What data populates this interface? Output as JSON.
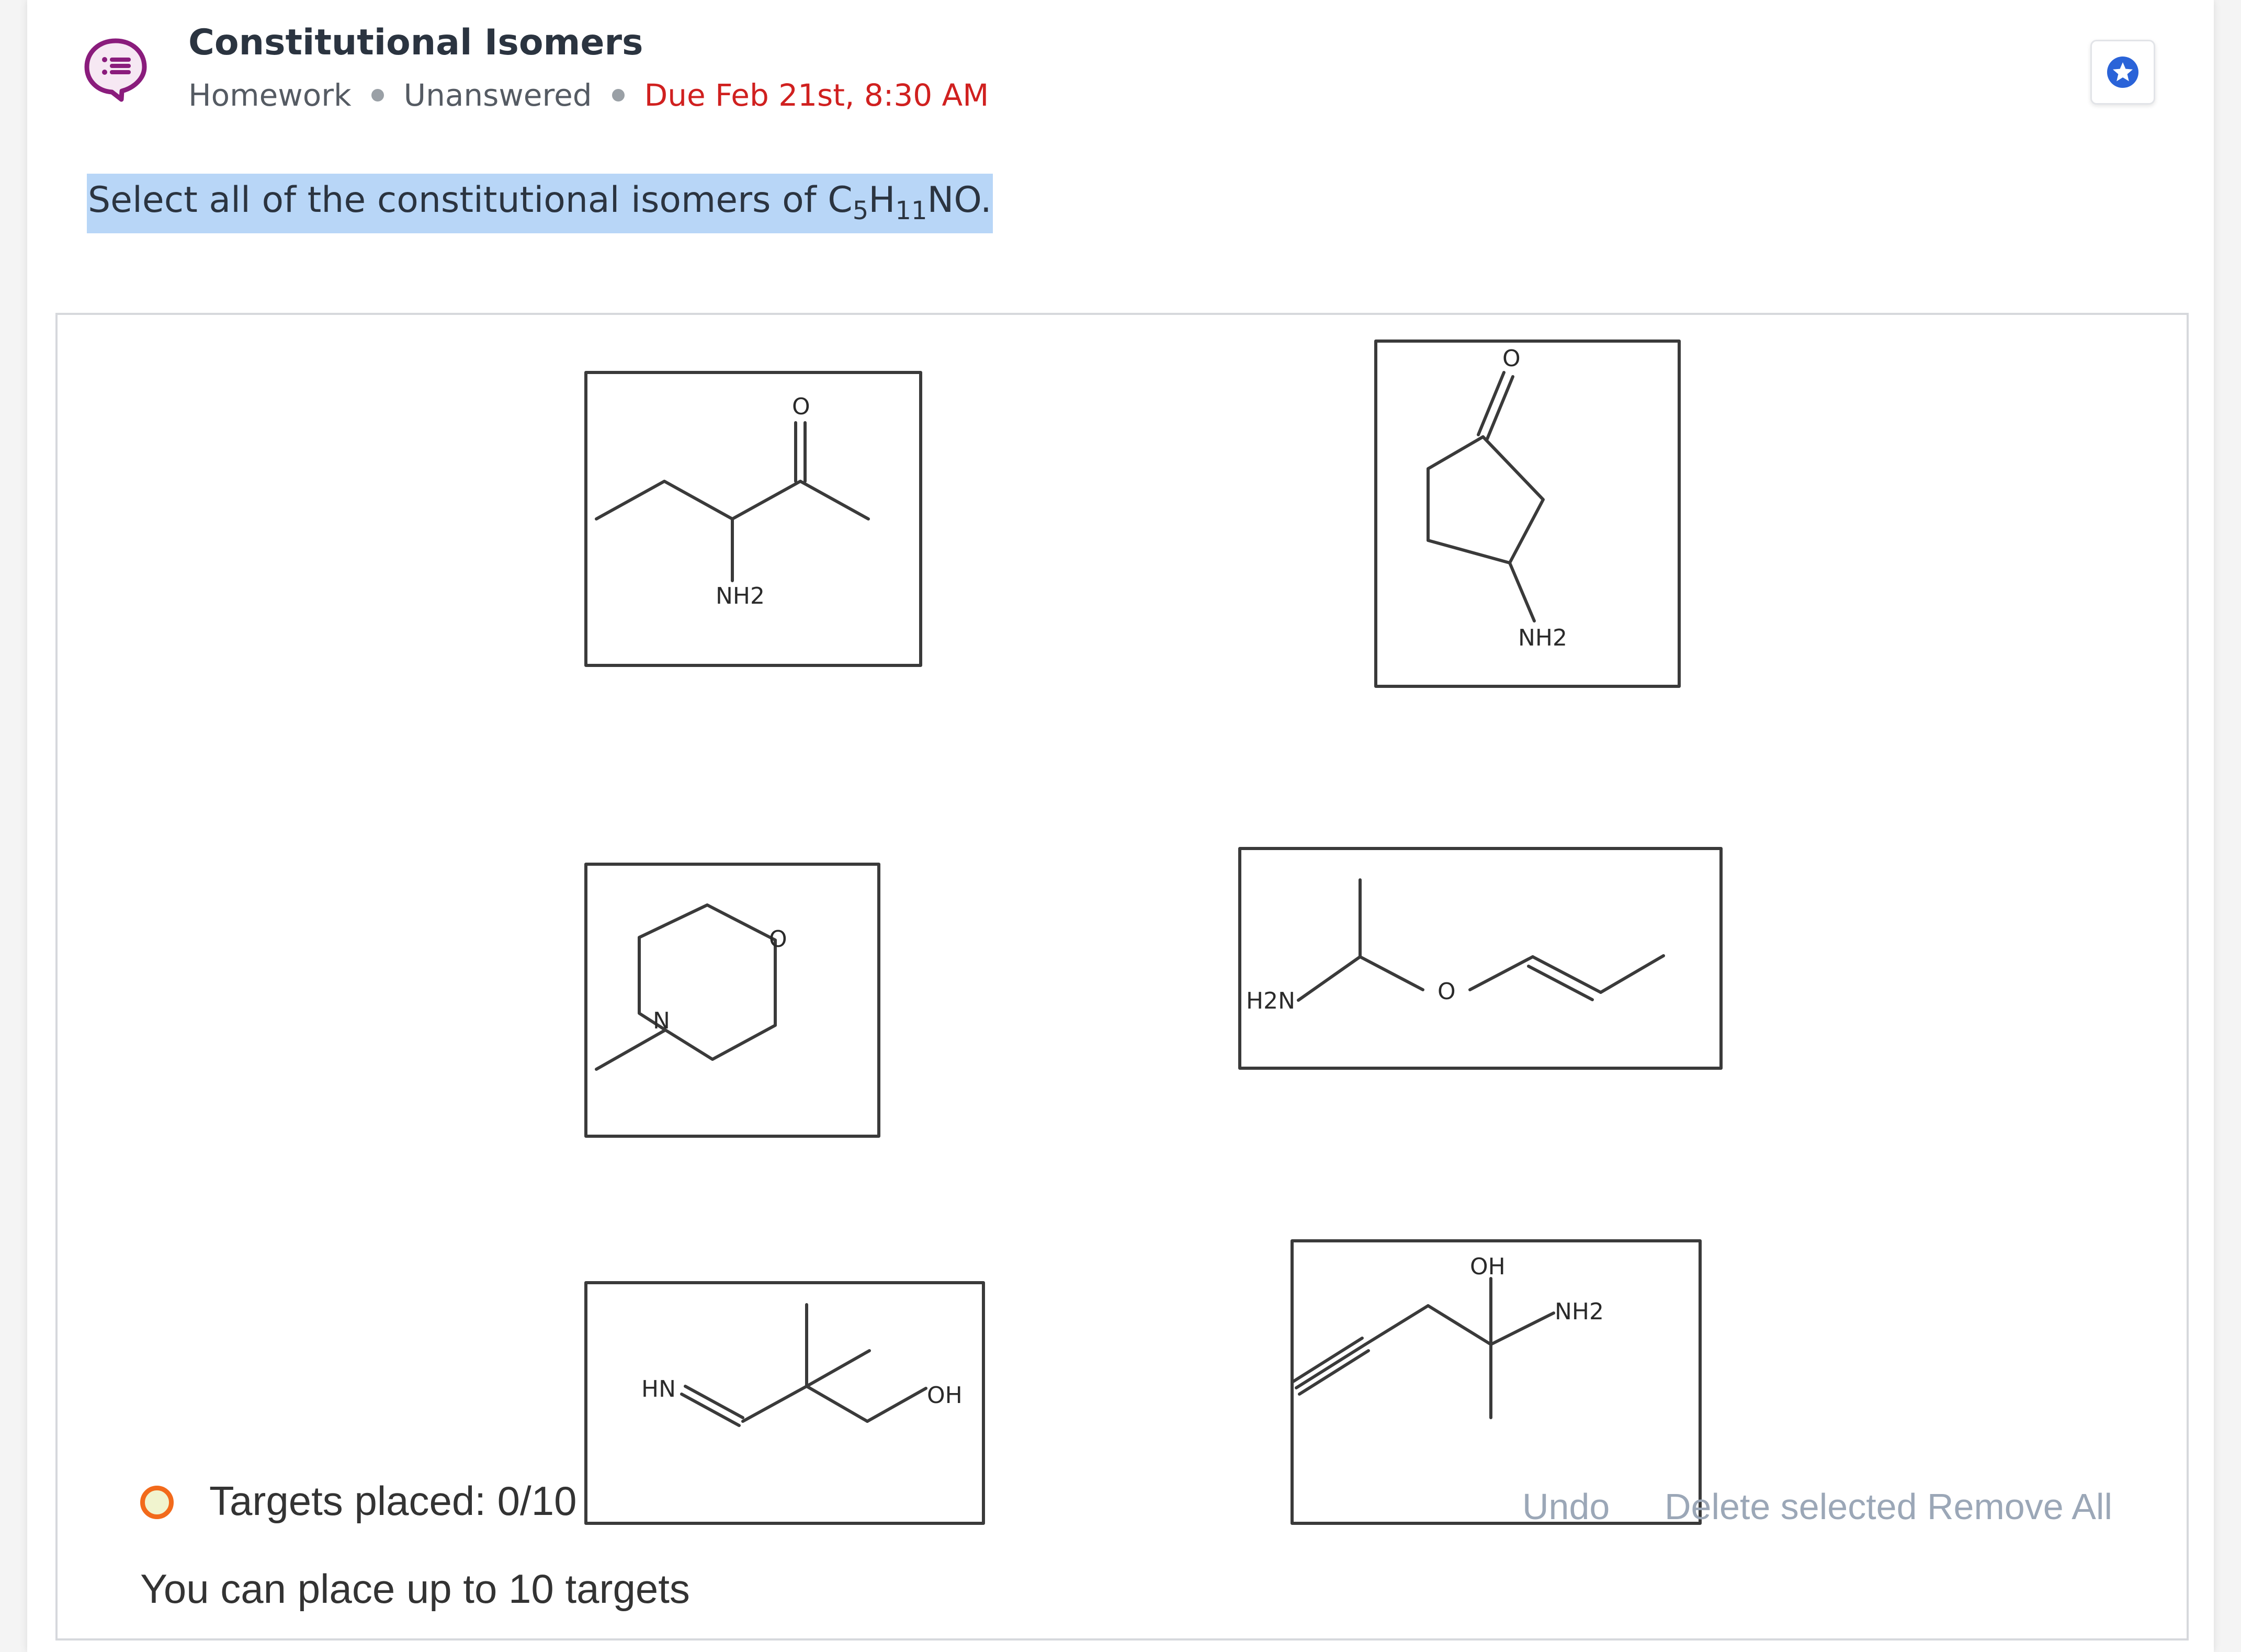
{
  "header": {
    "title": "Constitutional Isomers",
    "type": "Homework",
    "status": "Unanswered",
    "due": "Due Feb 21st, 8:30 AM"
  },
  "question": {
    "text_before": "Select all of the constitutional isomers of C",
    "sub1": "5",
    "mid": "H",
    "sub2": "11",
    "text_after": "NO."
  },
  "molecules": [
    {
      "id": "mol-1",
      "labels": [
        "O",
        "NH2"
      ]
    },
    {
      "id": "mol-2",
      "labels": [
        "O",
        "NH2"
      ]
    },
    {
      "id": "mol-3",
      "labels": [
        "O",
        "N"
      ]
    },
    {
      "id": "mol-4",
      "labels": [
        "H2N",
        "O"
      ]
    },
    {
      "id": "mol-5",
      "labels": [
        "HN",
        "OH"
      ]
    },
    {
      "id": "mol-6",
      "labels": [
        "OH",
        "NH2"
      ]
    }
  ],
  "targets": {
    "status": "Targets placed: 0/10",
    "hint": "You can place up to 10 targets"
  },
  "tools": {
    "undo": "Undo",
    "delete_selected": "Delete selected",
    "remove_all": "Remove All"
  },
  "colors": {
    "accent_purple": "#8a1c7c",
    "due_red": "#d0201f",
    "star_blue": "#2a63d8",
    "highlight": "#b8d6f7",
    "ring_orange": "#f26a1b",
    "tool_gray": "#9ba7b7"
  },
  "icons": {
    "question": "chat-list-icon",
    "favorite": "star-icon",
    "status": "target-ring-icon"
  }
}
